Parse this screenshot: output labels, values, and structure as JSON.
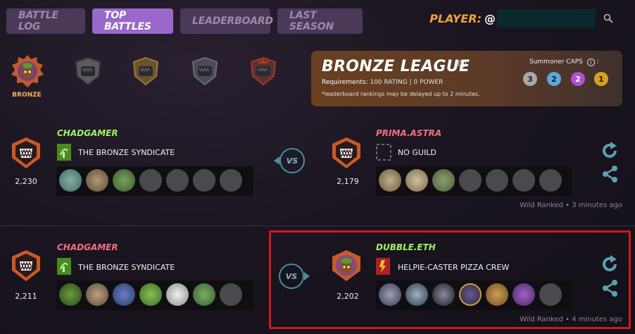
{
  "tabs": [
    {
      "label": "BATTLE LOG",
      "active": false
    },
    {
      "label": "TOP BATTLES",
      "active": true
    },
    {
      "label": "LEADERBOARD",
      "active": false
    },
    {
      "label": "LAST SEASON",
      "active": false
    }
  ],
  "player": {
    "label": "PLAYER:",
    "at": "@",
    "value": ""
  },
  "leagues": {
    "selected_name": "BRONZE",
    "items": [
      "bronze",
      "silver",
      "gold",
      "diamond",
      "champion"
    ]
  },
  "league_card": {
    "title": "BRONZE LEAGUE",
    "requirements_label": "Requirements:",
    "requirements_value": "100 RATING | 0 POWER",
    "delay_note": "*leaderboard rankings may be delayed up to 2 minutes.",
    "caps_label": "Summoner CAPS",
    "caps_suffix": ":",
    "caps": [
      "3",
      "2",
      "2",
      "1"
    ],
    "cap_colors": [
      "#a8a8a8",
      "#5aaad8",
      "#b050d0",
      "#d8a020"
    ]
  },
  "battles": [
    {
      "left": {
        "name": "CHADGAMER",
        "guild": "THE BRONZE SYNDICATE",
        "rating": "2,230",
        "cards_filled": 3,
        "cards_total": 7
      },
      "right": {
        "name": "PRIMA.ASTRA",
        "guild": "NO GUILD",
        "rating": "2,179",
        "cards_filled": 3,
        "cards_total": 7
      },
      "vs": "VS",
      "meta": "Wild Ranked • 3 minutes ago"
    },
    {
      "left": {
        "name": "CHADGAMER",
        "guild": "THE BRONZE SYNDICATE",
        "rating": "2,211",
        "cards_filled": 6,
        "cards_total": 7
      },
      "right": {
        "name": "DUBBLE.ETH",
        "guild": "HELPIE-CASTER PIZZA CREW",
        "rating": "2,202",
        "cards_filled": 6,
        "cards_total": 7
      },
      "vs": "VS",
      "meta": "Wild Ranked • 4 minutes ago"
    }
  ],
  "colors": {
    "active_tab": "#9a68c8",
    "player_green": "#a0f060",
    "player_pink": "#f07080",
    "highlight": "#d01820"
  }
}
